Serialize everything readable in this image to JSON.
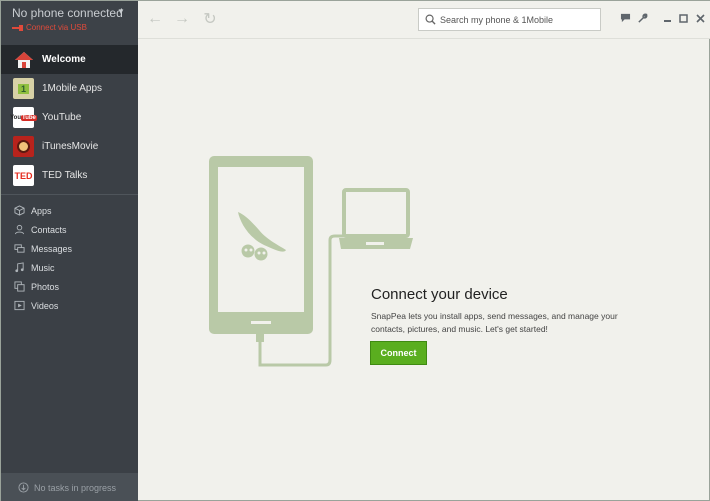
{
  "phone": {
    "title": "No phone connected",
    "connect_usb": "Connect via USB"
  },
  "sidebar": {
    "items": [
      {
        "label": "Welcome",
        "icon": "home-icon"
      },
      {
        "label": "1Mobile Apps",
        "icon": "1mobile-icon"
      },
      {
        "label": "YouTube",
        "icon": "youtube-icon"
      },
      {
        "label": "iTunesMovie",
        "icon": "itunesmovie-icon"
      },
      {
        "label": "TED Talks",
        "icon": "ted-icon"
      }
    ],
    "icon_text": {
      "one_mobile": "1",
      "youtube_you": "You",
      "youtube_tube": "Tube",
      "ted": "TED"
    },
    "sub_items": [
      {
        "label": "Apps",
        "icon": "cube-icon"
      },
      {
        "label": "Contacts",
        "icon": "person-icon"
      },
      {
        "label": "Messages",
        "icon": "chat-icon"
      },
      {
        "label": "Music",
        "icon": "music-icon"
      },
      {
        "label": "Photos",
        "icon": "photos-icon"
      },
      {
        "label": "Videos",
        "icon": "play-icon"
      }
    ],
    "tasks": "No tasks in progress"
  },
  "toolbar": {
    "search_placeholder": "Search my phone & 1Mobile"
  },
  "main": {
    "title": "Connect your device",
    "description": "SnapPea lets you install apps, send messages, and manage your contacts, pictures, and music. Let's get started!",
    "button": "Connect"
  },
  "colors": {
    "sidebar_bg": "#3b4046",
    "active_bg": "#24282c",
    "accent_green": "#5aae1f",
    "illustration": "#b5c7a4",
    "usb_red": "#e04a3b"
  }
}
